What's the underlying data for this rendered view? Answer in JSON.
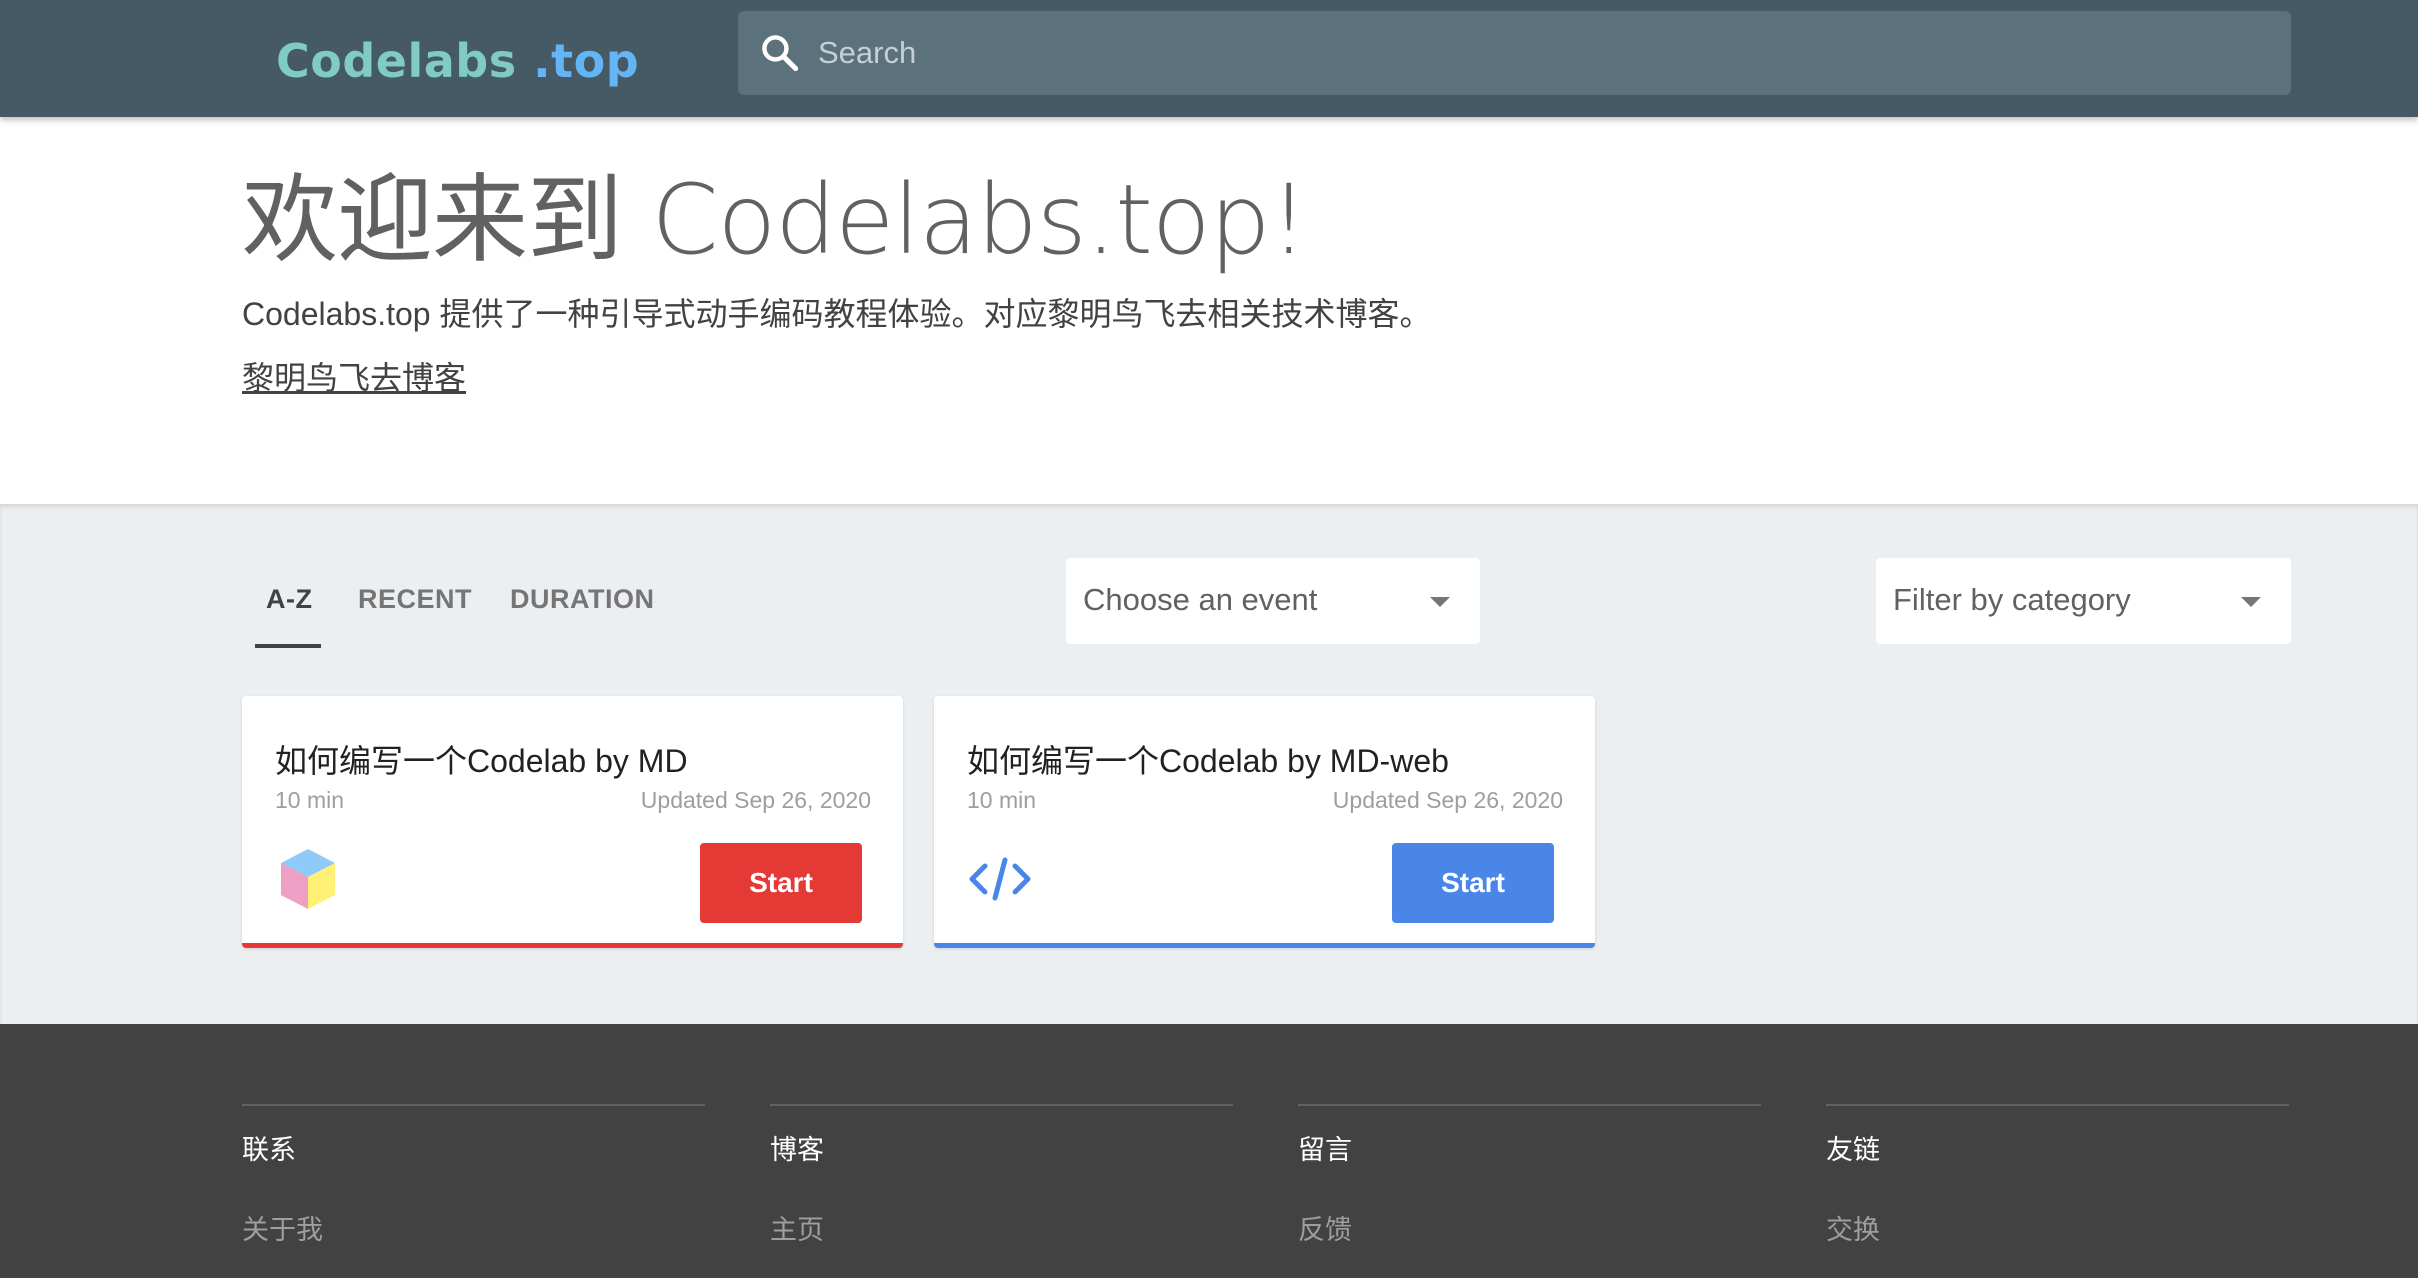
{
  "header": {
    "logo_part1": "Codelabs",
    "logo_part2": ".top",
    "search_placeholder": "Search"
  },
  "hero": {
    "title": "欢迎来到 Codelabs.top!",
    "description": "Codelabs.top 提供了一种引导式动手编码教程体验。对应黎明鸟飞去相关技术博客。",
    "blog_link": "黎明鸟飞去博客"
  },
  "tabs": [
    {
      "label": "A-Z",
      "active": true
    },
    {
      "label": "RECENT",
      "active": false
    },
    {
      "label": "DURATION",
      "active": false
    }
  ],
  "filters": {
    "event": "Choose an event",
    "category": "Filter by category"
  },
  "cards": [
    {
      "title": "如何编写一个Codelab by MD",
      "duration": "10 min",
      "updated": "Updated Sep 26, 2020",
      "start": "Start",
      "icon": "cube-icon",
      "accent": "#e53935"
    },
    {
      "title": "如何编写一个Codelab by MD-web",
      "duration": "10 min",
      "updated": "Updated Sep 26, 2020",
      "start": "Start",
      "icon": "code-icon",
      "accent": "#4a86e8"
    }
  ],
  "footer": [
    {
      "heading": "联系",
      "link": "关于我"
    },
    {
      "heading": "博客",
      "link": "主页"
    },
    {
      "heading": "留言",
      "link": "反馈"
    },
    {
      "heading": "友链",
      "link": "交换"
    }
  ],
  "colors": {
    "header_bg": "#455a64",
    "main_bg": "#eceff1",
    "footer_bg": "#424242",
    "card1_accent": "#e53935",
    "card2_accent": "#4a86e8"
  }
}
